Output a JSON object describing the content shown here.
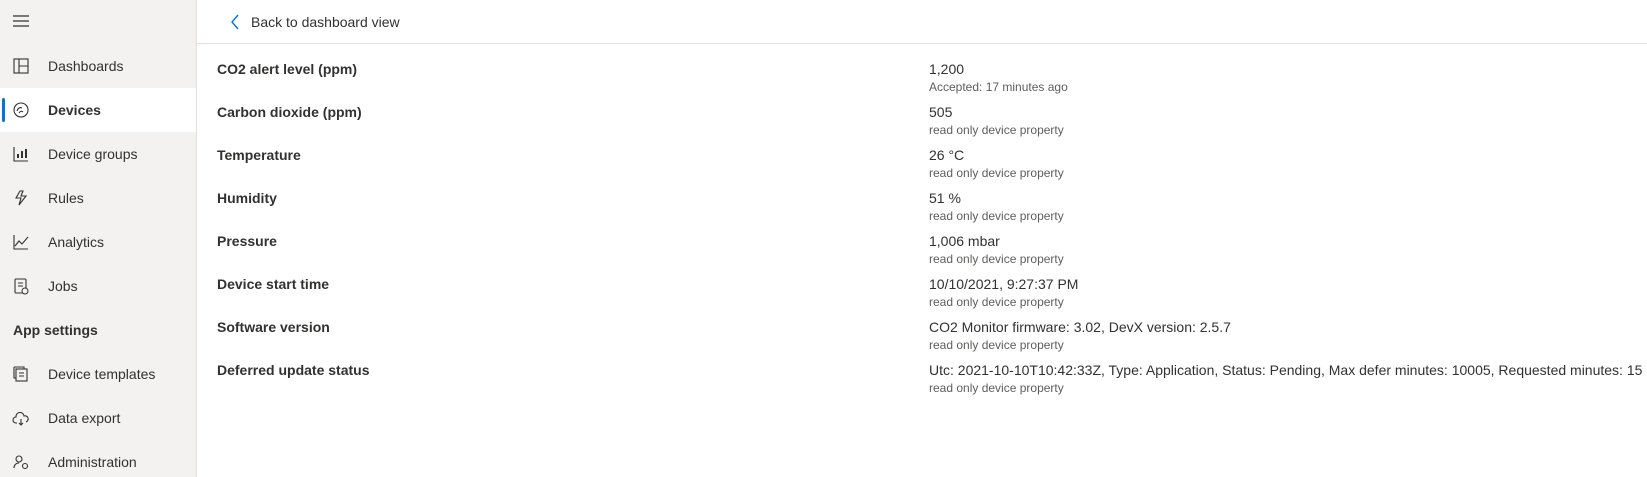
{
  "sidebar": {
    "items": [
      {
        "label": "Dashboards",
        "icon": "dashboard-icon"
      },
      {
        "label": "Devices",
        "icon": "devices-icon",
        "selected": true
      },
      {
        "label": "Device groups",
        "icon": "device-groups-icon"
      },
      {
        "label": "Rules",
        "icon": "rules-icon"
      },
      {
        "label": "Analytics",
        "icon": "analytics-icon"
      },
      {
        "label": "Jobs",
        "icon": "jobs-icon"
      }
    ],
    "section_label": "App settings",
    "settings_items": [
      {
        "label": "Device templates",
        "icon": "device-templates-icon"
      },
      {
        "label": "Data export",
        "icon": "data-export-icon"
      },
      {
        "label": "Administration",
        "icon": "administration-icon"
      }
    ]
  },
  "topbar": {
    "back_label": "Back to dashboard view"
  },
  "properties": [
    {
      "name": "CO2 alert level (ppm)",
      "value": "1,200",
      "sub": "Accepted: 17 minutes ago"
    },
    {
      "name": "Carbon dioxide (ppm)",
      "value": "505",
      "sub": "read only device property"
    },
    {
      "name": "Temperature",
      "value": "26 °C",
      "sub": "read only device property"
    },
    {
      "name": "Humidity",
      "value": "51 %",
      "sub": "read only device property"
    },
    {
      "name": "Pressure",
      "value": "1,006 mbar",
      "sub": "read only device property"
    },
    {
      "name": "Device start time",
      "value": "10/10/2021, 9:27:37 PM",
      "sub": "read only device property"
    },
    {
      "name": "Software version",
      "value": "CO2 Monitor firmware: 3.02, DevX version: 2.5.7",
      "sub": "read only device property"
    },
    {
      "name": "Deferred update status",
      "value": "Utc: 2021-10-10T10:42:33Z, Type: Application, Status: Pending, Max defer minutes: 10005, Requested minutes: 15",
      "sub": "read only device property"
    }
  ],
  "colors": {
    "accent": "#0078d4",
    "sidebar_bg": "#f3f2f1"
  }
}
